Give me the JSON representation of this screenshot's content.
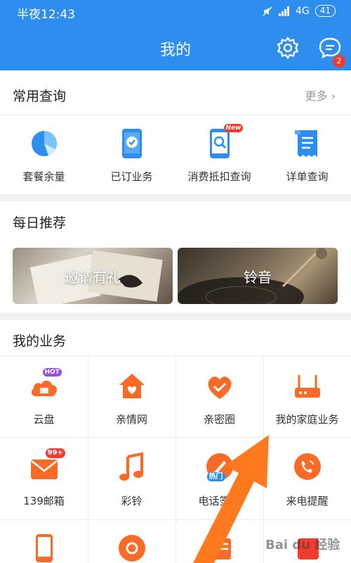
{
  "status": {
    "time": "半夜12:43",
    "network": "4G",
    "battery": "41"
  },
  "header": {
    "title": "我的",
    "message_count": "2"
  },
  "common_query": {
    "title": "常用查询",
    "more": "更多",
    "items": [
      {
        "label": "套餐余量",
        "icon": "pie-chart-icon"
      },
      {
        "label": "已订业务",
        "icon": "phone-check-icon"
      },
      {
        "label": "消费抵扣查询",
        "icon": "phone-search-icon",
        "tag": "New"
      },
      {
        "label": "详单查询",
        "icon": "receipt-icon"
      }
    ]
  },
  "daily": {
    "title": "每日推荐",
    "banners": [
      {
        "label": "邀请有礼"
      },
      {
        "label": "铃音"
      }
    ]
  },
  "business": {
    "title": "我的业务",
    "row1": [
      {
        "label": "云盘",
        "icon": "cloud-drive-icon",
        "tag": "HOT"
      },
      {
        "label": "亲情网",
        "icon": "home-heart-icon"
      },
      {
        "label": "亲密圈",
        "icon": "handshake-heart-icon"
      },
      {
        "label": "我的家庭业务",
        "icon": "router-icon"
      }
    ],
    "row2": [
      {
        "label": "139邮箱",
        "icon": "mail-icon",
        "tag": "99+"
      },
      {
        "label": "彩铃",
        "icon": "music-note-icon"
      },
      {
        "label": "电话签名",
        "icon": "pen-icon",
        "tag": "热门"
      },
      {
        "label": "来电提醒",
        "icon": "phone-ring-icon"
      }
    ]
  },
  "watermark": "Bai du 经验"
}
